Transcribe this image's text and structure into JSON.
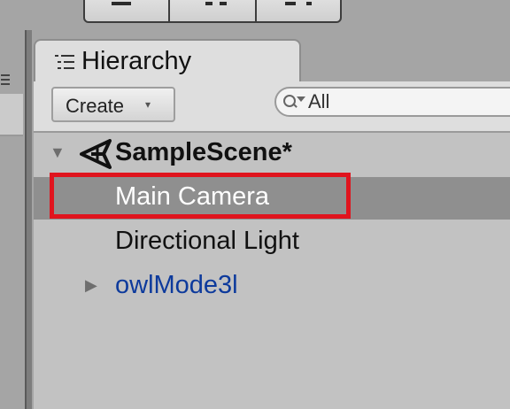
{
  "window": {
    "tab_label": "Hierarchy",
    "tab_icon": "hierarchy-list-icon"
  },
  "toolbar": {
    "create_label": "Create",
    "create_arrow": "▾",
    "search": {
      "icon": "search-filter-icon",
      "placeholder": "All"
    }
  },
  "tree": {
    "scene": {
      "name": "SampleScene*",
      "icon": "unity-logo-icon",
      "expanded": true,
      "foldout": "▼"
    },
    "items": [
      {
        "label": "Main Camera",
        "selected": true,
        "color": "#ffffff"
      },
      {
        "label": "Directional Light",
        "selected": false,
        "color": "#111111"
      },
      {
        "label": "owlMode3l",
        "selected": false,
        "color": "#0d3a9c",
        "foldout": "▶",
        "prefab": true
      }
    ]
  },
  "annotation": {
    "highlight_color": "#e0141e",
    "target": "Main Camera"
  },
  "colors": {
    "selection": "#8f8f8f",
    "panel": "#c2c2c2",
    "prefab_text": "#0d3a9c"
  }
}
